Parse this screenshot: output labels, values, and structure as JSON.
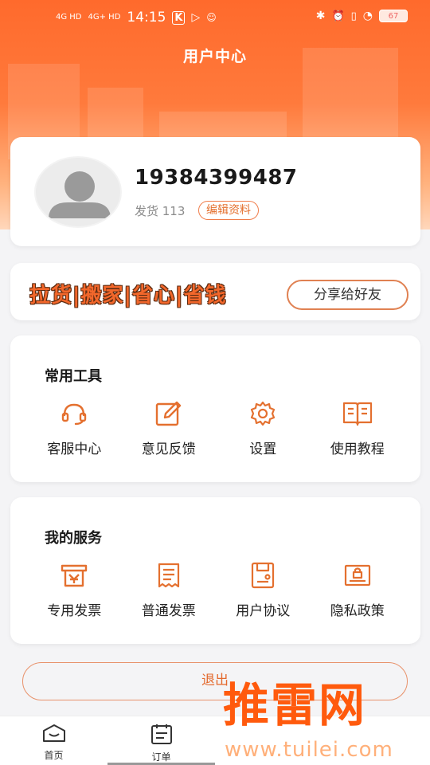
{
  "status_bar": {
    "signal_1": "4G HD",
    "signal_2": "4G+ HD",
    "time": "14:15",
    "battery": "67"
  },
  "header": {
    "title": "用户中心"
  },
  "profile": {
    "phone": "19384399487",
    "shipments": "发货 113",
    "edit_label": "编辑资料"
  },
  "banner": {
    "slogan": "拉货|搬家|省心|省钱",
    "share_label": "分享给好友"
  },
  "tools": {
    "title": "常用工具",
    "items": [
      {
        "label": "客服中心",
        "icon": "headset-icon"
      },
      {
        "label": "意见反馈",
        "icon": "feedback-edit-icon"
      },
      {
        "label": "设置",
        "icon": "gear-icon"
      },
      {
        "label": "使用教程",
        "icon": "book-icon"
      }
    ]
  },
  "services": {
    "title": "我的服务",
    "items": [
      {
        "label": "专用发票",
        "icon": "special-invoice-icon"
      },
      {
        "label": "普通发票",
        "icon": "invoice-icon"
      },
      {
        "label": "用户协议",
        "icon": "agreement-icon"
      },
      {
        "label": "隐私政策",
        "icon": "privacy-lock-icon"
      }
    ]
  },
  "logout_label": "退出",
  "tabbar": [
    {
      "label": "首页",
      "icon": "home-icon"
    },
    {
      "label": "订单",
      "icon": "order-list-icon"
    }
  ],
  "watermark": {
    "brand": "推雷网",
    "url": "www.tuilei.com"
  },
  "colors": {
    "accent": "#f2672b",
    "header_gradient_top": "#ff6a2c"
  }
}
